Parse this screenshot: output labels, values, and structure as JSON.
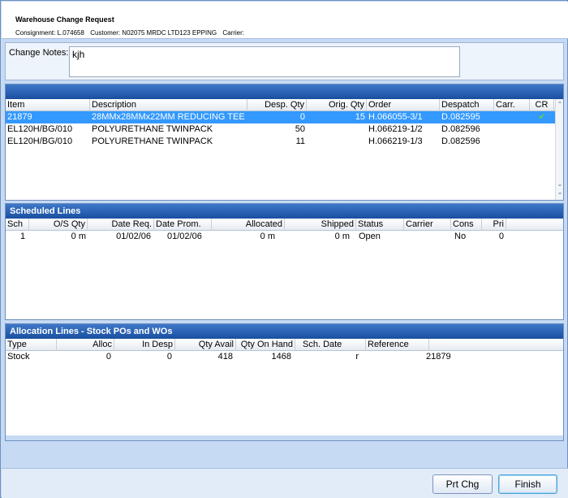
{
  "header": {
    "title": "Warehouse Change Request",
    "consignment": "Consignment: L.074658",
    "customer": "Customer: N02075 MRDC LTD123 EPPING",
    "carrier": "Carrier:"
  },
  "notes": {
    "label": "Change Notes:",
    "value": "kjh"
  },
  "items": {
    "columns": [
      "Item",
      "Description",
      "Desp. Qty",
      "Orig. Qty",
      "Order",
      "Despatch",
      "Carr.",
      "CR"
    ],
    "rows": [
      {
        "item": "21879",
        "description": "28MMx28MMx22MM REDUCING TEE",
        "desp_qty": "0",
        "orig_qty": "15",
        "order": "H.066055-3/1",
        "despatch": "D.082595",
        "carr": "",
        "cr": "✔"
      },
      {
        "item": "EL120H/BG/010",
        "description": "POLYURETHANE TWINPACK",
        "desp_qty": "50",
        "orig_qty": "",
        "order": "H.066219-1/2",
        "despatch": "D.082596",
        "carr": "",
        "cr": ""
      },
      {
        "item": "EL120H/BG/010",
        "description": "POLYURETHANE TWINPACK",
        "desp_qty": "11",
        "orig_qty": "",
        "order": "H.066219-1/3",
        "despatch": "D.082596",
        "carr": "",
        "cr": ""
      }
    ]
  },
  "scheduled": {
    "title": "Scheduled Lines",
    "columns": [
      "Sch",
      "O/S Qty",
      "Date Req.",
      "Date Prom.",
      "Allocated",
      "Shipped",
      "Status",
      "Carrier",
      "Cons",
      "Pri"
    ],
    "rows": [
      {
        "sch": "1",
        "os_qty": "0 m",
        "date_req": "01/02/06",
        "date_prom": "01/02/06",
        "allocated": "0 m",
        "shipped": "0 m",
        "status": "Open",
        "carrier": "",
        "cons": "No",
        "pri": "0"
      }
    ]
  },
  "allocation": {
    "title": "Allocation Lines - Stock POs and WOs",
    "columns": [
      "Type",
      "Alloc",
      "In Desp",
      "Qty Avail",
      "Qty On Hand",
      "Sch. Date",
      "Reference"
    ],
    "rows": [
      {
        "type": "Stock",
        "alloc": "0",
        "in_desp": "0",
        "qty_avail": "418",
        "qty_on_hand": "1468",
        "sch_date": "r",
        "reference": "21879"
      }
    ]
  },
  "buttons": {
    "prt_chg": "Prt Chg",
    "finish": "Finish"
  }
}
